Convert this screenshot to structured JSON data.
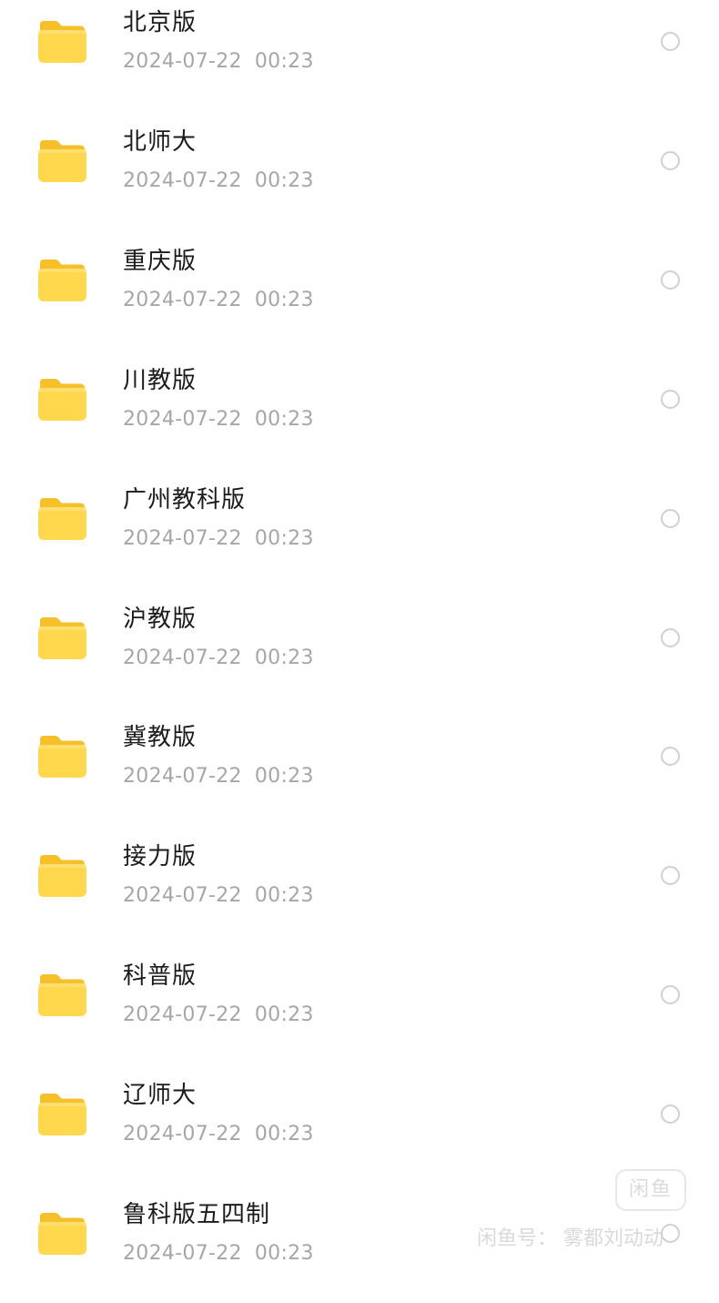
{
  "files": [
    {
      "name": "北京版",
      "date": "2024-07-22",
      "time": "00:23",
      "icon": "folder-icon"
    },
    {
      "name": "北师大",
      "date": "2024-07-22",
      "time": "00:23",
      "icon": "folder-icon"
    },
    {
      "name": "重庆版",
      "date": "2024-07-22",
      "time": "00:23",
      "icon": "folder-icon"
    },
    {
      "name": "川教版",
      "date": "2024-07-22",
      "time": "00:23",
      "icon": "folder-icon"
    },
    {
      "name": "广州教科版",
      "date": "2024-07-22",
      "time": "00:23",
      "icon": "folder-icon"
    },
    {
      "name": "沪教版",
      "date": "2024-07-22",
      "time": "00:23",
      "icon": "folder-icon"
    },
    {
      "name": "冀教版",
      "date": "2024-07-22",
      "time": "00:23",
      "icon": "folder-icon"
    },
    {
      "name": "接力版",
      "date": "2024-07-22",
      "time": "00:23",
      "icon": "folder-icon"
    },
    {
      "name": "科普版",
      "date": "2024-07-22",
      "time": "00:23",
      "icon": "folder-icon"
    },
    {
      "name": "辽师大",
      "date": "2024-07-22",
      "time": "00:23",
      "icon": "folder-icon"
    },
    {
      "name": "鲁科版五四制",
      "date": "2024-07-22",
      "time": "00:23",
      "icon": "folder-icon"
    }
  ],
  "watermark": {
    "logo_text": "闲鱼",
    "text": "闲鱼号： 雾都刘动动"
  },
  "colors": {
    "folder_back": "#f5c02a",
    "folder_front": "#ffd84d",
    "name_text": "#1b1b1b",
    "date_text": "#a6a6a6",
    "radio_border": "#d0d0d0"
  }
}
